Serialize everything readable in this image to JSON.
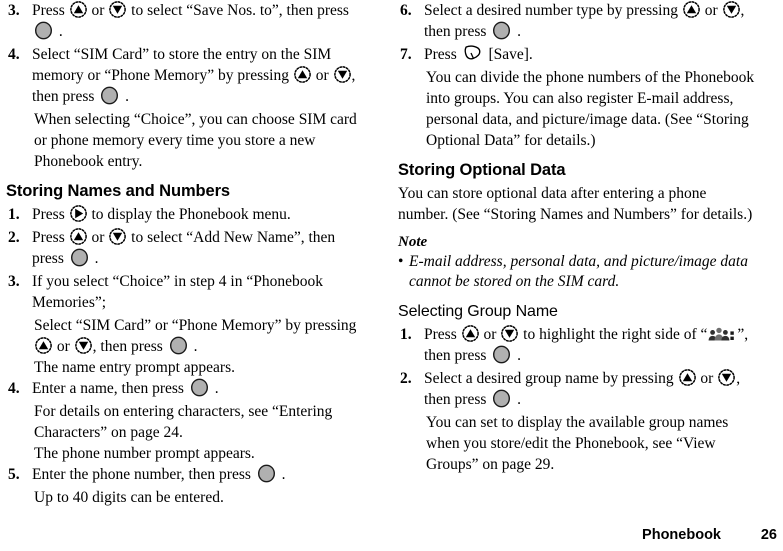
{
  "document": {
    "type": "mobile-phone-user-manual-page",
    "footer": {
      "section": "Phonebook",
      "page_number": "26"
    }
  },
  "icons": {
    "up": "up-key-icon",
    "down": "down-key-icon",
    "right": "right-key-icon",
    "center": "center-select-key-icon",
    "softkey_left": "left-softkey-icon",
    "group": "group-people-icon"
  },
  "left_column": {
    "steps_continued": [
      {
        "number": "3.",
        "parts": [
          {
            "t": "text",
            "v": "Press "
          },
          {
            "t": "icon",
            "v": "up"
          },
          {
            "t": "text",
            "v": " or "
          },
          {
            "t": "icon",
            "v": "down"
          },
          {
            "t": "text",
            "v": " to select “Save Nos. to”, then press "
          },
          {
            "t": "icon",
            "v": "center"
          },
          {
            "t": "text",
            "v": " ."
          }
        ],
        "plain": "Press up or down to select “Save Nos. to”, then press center key."
      },
      {
        "number": "4.",
        "parts": [
          {
            "t": "text",
            "v": "Select “SIM Card” to store the entry on the SIM memory or “Phone Memory” by pressing "
          },
          {
            "t": "icon",
            "v": "up"
          },
          {
            "t": "text",
            "v": " or "
          },
          {
            "t": "icon",
            "v": "down"
          },
          {
            "t": "text",
            "v": ", then press "
          },
          {
            "t": "icon",
            "v": "center"
          },
          {
            "t": "text",
            "v": " ."
          }
        ],
        "plain": "Select “SIM Card” to store the entry on the SIM memory or “Phone Memory” by pressing up or down, then press center key.",
        "note": "When selecting “Choice”, you can choose SIM card or phone memory every time you store a new Phonebook entry."
      }
    ],
    "heading": "Storing Names and Numbers",
    "steps": [
      {
        "number": "1.",
        "parts": [
          {
            "t": "text",
            "v": "Press "
          },
          {
            "t": "icon",
            "v": "right"
          },
          {
            "t": "text",
            "v": " to display the Phonebook menu."
          }
        ],
        "plain": "Press right to display the Phonebook menu."
      },
      {
        "number": "2.",
        "parts": [
          {
            "t": "text",
            "v": "Press "
          },
          {
            "t": "icon",
            "v": "up"
          },
          {
            "t": "text",
            "v": " or "
          },
          {
            "t": "icon",
            "v": "down"
          },
          {
            "t": "text",
            "v": " to select “Add New Name”, then press "
          },
          {
            "t": "icon",
            "v": "center"
          },
          {
            "t": "text",
            "v": " ."
          }
        ],
        "plain": "Press up or down to select “Add New Name”, then press center key."
      },
      {
        "number": "3.",
        "parts": [
          {
            "t": "text",
            "v": "If you select “Choice” in step 4 in “Phonebook Memories”;"
          }
        ],
        "plain": "If you select “Choice” in step 4 in “Phonebook Memories”;",
        "sub_parts": [
          {
            "t": "text",
            "v": "Select “SIM Card” or “Phone Memory” by pressing "
          },
          {
            "t": "icon",
            "v": "up"
          },
          {
            "t": "text",
            "v": " or "
          },
          {
            "t": "icon",
            "v": "down"
          },
          {
            "t": "text",
            "v": ", then press "
          },
          {
            "t": "icon",
            "v": "center"
          },
          {
            "t": "text",
            "v": " ."
          }
        ],
        "sub_plain": "Select “SIM Card” or “Phone Memory” by pressing up or down, then press center key.",
        "note": "The name entry prompt appears."
      },
      {
        "number": "4.",
        "parts": [
          {
            "t": "text",
            "v": "Enter a name, then press "
          },
          {
            "t": "icon",
            "v": "center"
          },
          {
            "t": "text",
            "v": " ."
          }
        ],
        "plain": "Enter a name, then press center key.",
        "note": "For details on entering characters, see “Entering Characters” on page 24.",
        "note2": "The phone number prompt appears."
      },
      {
        "number": "5.",
        "parts": [
          {
            "t": "text",
            "v": "Enter the phone number, then press "
          },
          {
            "t": "icon",
            "v": "center"
          },
          {
            "t": "text",
            "v": " ."
          }
        ],
        "plain": "Enter the phone number, then press center key.",
        "note": "Up to 40 digits can be entered."
      }
    ]
  },
  "right_column": {
    "steps_continued": [
      {
        "number": "6.",
        "parts": [
          {
            "t": "text",
            "v": "Select a desired number type by pressing "
          },
          {
            "t": "icon",
            "v": "up"
          },
          {
            "t": "text",
            "v": " or "
          },
          {
            "t": "icon",
            "v": "down"
          },
          {
            "t": "text",
            "v": ", then press "
          },
          {
            "t": "icon",
            "v": "center"
          },
          {
            "t": "text",
            "v": " ."
          }
        ],
        "plain": "Select a desired number type by pressing up or down, then press center key."
      },
      {
        "number": "7.",
        "parts": [
          {
            "t": "text",
            "v": "Press "
          },
          {
            "t": "icon",
            "v": "softkey_left"
          },
          {
            "t": "text",
            "v": " [Save]."
          }
        ],
        "plain": "Press left softkey [Save].",
        "note": "You can divide the phone numbers of the Phonebook into groups. You can also register E-mail address, personal data, and picture/image data. (See “Storing Optional Data”  for details.)"
      }
    ],
    "heading": "Storing Optional Data",
    "intro": "You can store optional data after entering a phone number. (See “Storing Names and Numbers” for details.)",
    "note_heading": "Note",
    "note_bullet": "•",
    "note_items": [
      "E-mail address, personal data, and picture/image data cannot be stored on the SIM card."
    ],
    "subheading": "Selecting Group Name",
    "steps": [
      {
        "number": "1.",
        "parts": [
          {
            "t": "text",
            "v": "Press "
          },
          {
            "t": "icon",
            "v": "up"
          },
          {
            "t": "text",
            "v": " or "
          },
          {
            "t": "icon",
            "v": "down"
          },
          {
            "t": "text",
            "v": " to highlight the right side of “"
          },
          {
            "t": "icon",
            "v": "group"
          },
          {
            "t": "text",
            "v": "”, then press "
          },
          {
            "t": "icon",
            "v": "center"
          },
          {
            "t": "text",
            "v": " ."
          }
        ],
        "plain": "Press up or down to highlight the right side of “group icon”, then press center key."
      },
      {
        "number": "2.",
        "parts": [
          {
            "t": "text",
            "v": "Select a desired group name by pressing "
          },
          {
            "t": "icon",
            "v": "up"
          },
          {
            "t": "text",
            "v": " or "
          },
          {
            "t": "icon",
            "v": "down"
          },
          {
            "t": "text",
            "v": ", then press "
          },
          {
            "t": "icon",
            "v": "center"
          },
          {
            "t": "text",
            "v": " ."
          }
        ],
        "plain": "Select a desired group name by pressing up or down, then press center key.",
        "note": "You can set to display the available group names when you store/edit the Phonebook, see “View Groups” on page 29."
      }
    ]
  }
}
